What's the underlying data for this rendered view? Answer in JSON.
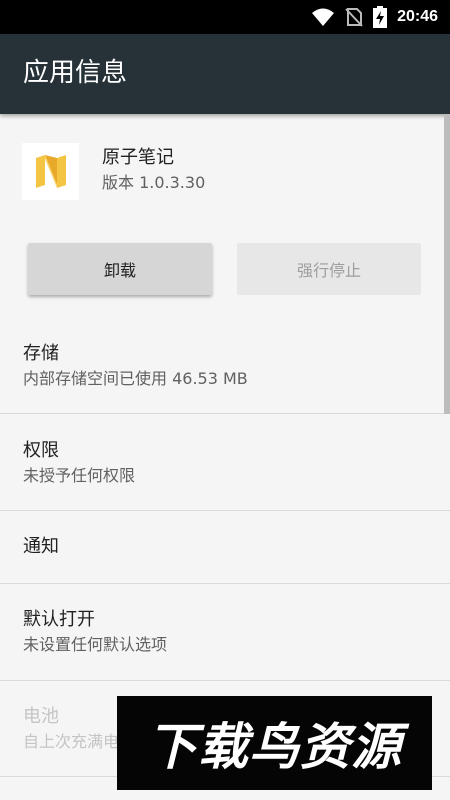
{
  "status_bar": {
    "time": "20:46",
    "icons": [
      "wifi-icon",
      "no-sim-icon",
      "battery-charging-icon"
    ]
  },
  "toolbar": {
    "title": "应用信息"
  },
  "app": {
    "name": "原子笔记",
    "version": "版本 1.0.3.30",
    "icon": "app-logo-icon",
    "icon_color": "#F4C443"
  },
  "buttons": {
    "uninstall": "卸载",
    "force_stop": "强行停止"
  },
  "sections": [
    {
      "title": "存储",
      "subtitle": "内部存储空间已使用 46.53 MB"
    },
    {
      "title": "权限",
      "subtitle": "未授予任何权限"
    },
    {
      "title": "通知"
    },
    {
      "title": "默认打开",
      "subtitle": "未设置任何默认选项"
    },
    {
      "title": "电池",
      "subtitle": "自上次充满电"
    }
  ],
  "watermark": {
    "text": "下载鸟资源"
  },
  "colors": {
    "toolbar": "#263238",
    "status_bar": "#000000",
    "background": "#F5F5F5"
  }
}
